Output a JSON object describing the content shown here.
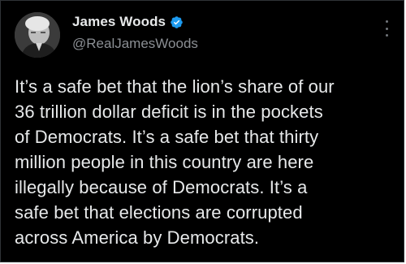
{
  "tweet": {
    "author_name": "James Woods",
    "author_handle": "@RealJamesWoods",
    "verified_icon": "verified-badge-icon",
    "more_icon": "more-options-icon",
    "body": "It’s a safe bet that the lion’s share of our\n36 trillion dollar deficit is in the pockets\nof Democrats. It’s a safe bet that thirty\nmillion people in this country are here\nillegally because of Democrats. It’s a\nsafe bet that elections are corrupted\nacross America by Democrats."
  },
  "colors": {
    "background": "#000000",
    "text_primary": "#e7e9ea",
    "text_secondary": "#8b8f94",
    "verified_blue": "#1d9bf0"
  }
}
